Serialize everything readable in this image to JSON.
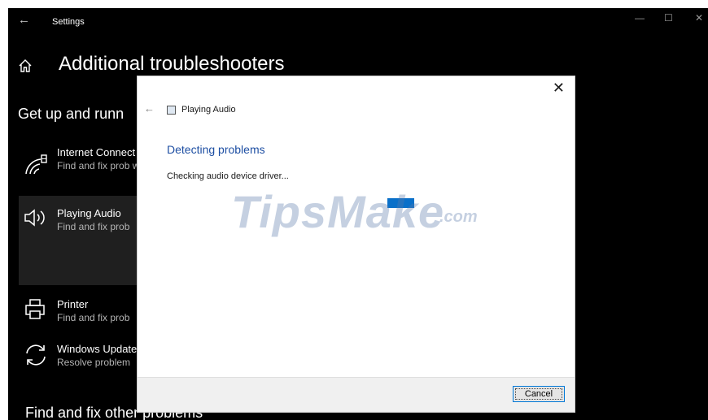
{
  "window": {
    "title": "Settings",
    "back_glyph": "←",
    "minimize_glyph": "—",
    "maximize_glyph": "☐",
    "close_glyph": "✕"
  },
  "page": {
    "title": "Additional troubleshooters",
    "section_top": "Get up and runn",
    "section_bottom": "Find and fix other problems"
  },
  "troubleshooters": [
    {
      "icon": "wifi-icon",
      "title": "Internet Connect",
      "desc": "Find and fix prob websites."
    },
    {
      "icon": "speaker-icon",
      "title": "Playing Audio",
      "desc": "Find and fix prob",
      "selected": true
    },
    {
      "icon": "printer-icon",
      "title": "Printer",
      "desc": "Find and fix prob"
    },
    {
      "icon": "sync-icon",
      "title": "Windows Update",
      "desc": "Resolve problem"
    }
  ],
  "dialog": {
    "close_glyph": "✕",
    "back_glyph": "←",
    "app_title": "Playing Audio",
    "heading": "Detecting problems",
    "status": "Checking audio device driver...",
    "cancel_label": "Cancel",
    "progress_indeterminate": true
  },
  "watermark": {
    "text": "TipsMake",
    "suffix": ".com"
  },
  "colors": {
    "settings_bg": "#000000",
    "accent": "#0078d7",
    "heading_blue": "#1e4fa3",
    "progress": "#0a70c9"
  }
}
